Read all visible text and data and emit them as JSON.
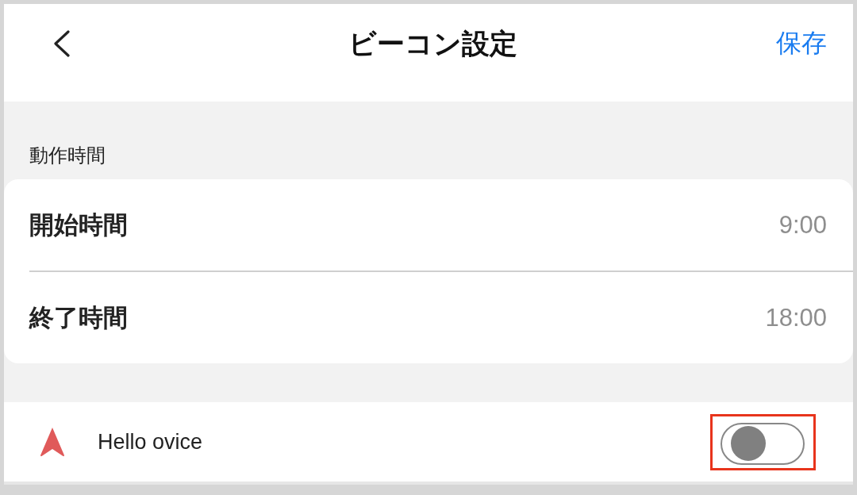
{
  "header": {
    "title": "ビーコン設定",
    "save_label": "保存"
  },
  "sections": [
    {
      "label": "動作時間",
      "rows": [
        {
          "label": "開始時間",
          "value": "9:00"
        },
        {
          "label": "終了時間",
          "value": "18:00"
        }
      ]
    }
  ],
  "beacons": [
    {
      "name": "Hello ovice",
      "on": false,
      "highlighted": true
    }
  ]
}
